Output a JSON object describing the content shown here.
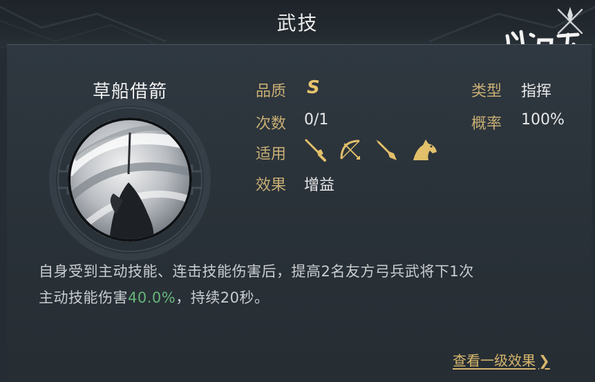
{
  "header": {
    "title": "武技",
    "logo_text": "鸿图之下"
  },
  "skill": {
    "name": "草船借箭",
    "icon": "arrow-whirlwind-skill-emblem"
  },
  "attributes": {
    "quality_label": "品质",
    "quality_value": "S",
    "count_label": "次数",
    "count_value": "0/1",
    "usable_label": "适用",
    "usable_icons": [
      "sword-icon",
      "bow-icon",
      "spear-icon",
      "horse-icon"
    ],
    "effect_label": "效果",
    "effect_value": "增益",
    "type_label": "类型",
    "type_value": "指挥",
    "chance_label": "概率",
    "chance_value": "100%"
  },
  "description": {
    "line1": "自身受到主动技能、连击技能伤害后，提高2名友方弓兵武将下1次",
    "line2_prefix": "主动技能伤害",
    "line2_highlight": "40.0%",
    "line2_suffix": "，持续20秒。"
  },
  "link": {
    "label": "查看一级效果",
    "chevron": "❯"
  },
  "colors": {
    "label_gold": "#c7ae74",
    "quality_gold": "#e6c46e",
    "highlight_green": "#67b57a",
    "link_gold": "#d8b76d",
    "background": "#252c33"
  }
}
